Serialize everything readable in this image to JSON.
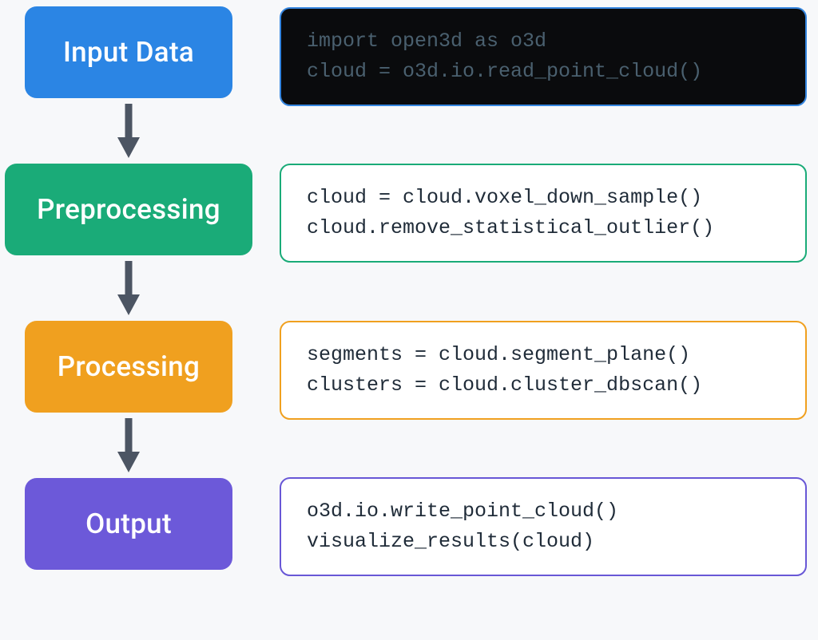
{
  "flow": {
    "stages": [
      {
        "label": "Input Data",
        "class": "stage-input"
      },
      {
        "label": "Preprocessing",
        "class": "stage-pre"
      },
      {
        "label": "Processing",
        "class": "stage-proc"
      },
      {
        "label": "Output",
        "class": "stage-out"
      }
    ]
  },
  "code": {
    "input": "import open3d as o3d\ncloud = o3d.io.read_point_cloud()",
    "pre": "cloud = cloud.voxel_down_sample()\ncloud.remove_statistical_outlier()",
    "proc": "segments = cloud.segment_plane()\nclusters = cloud.cluster_dbscan()",
    "out": "o3d.io.write_point_cloud()\nvisualize_results(cloud)"
  },
  "colors": {
    "input": "#2b85e4",
    "pre": "#1aab78",
    "proc": "#f0a01f",
    "out": "#6c59d9",
    "arrow": "#4c5563"
  }
}
